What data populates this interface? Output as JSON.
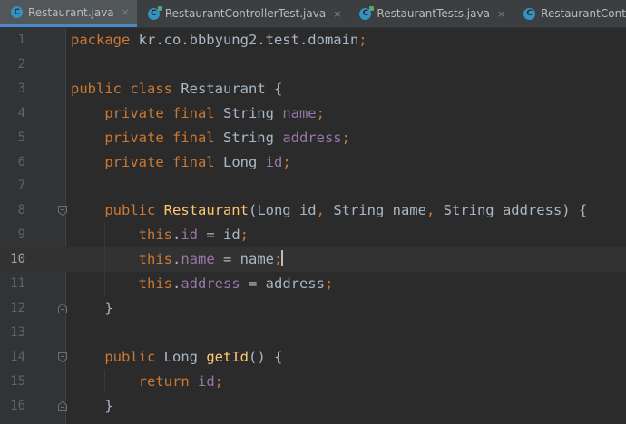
{
  "tabs": [
    {
      "label": "Restaurant.java",
      "icon": "class-icon",
      "active": true,
      "closable": true
    },
    {
      "label": "RestaurantControllerTest.java",
      "icon": "test-class-icon",
      "active": false,
      "closable": true
    },
    {
      "label": "RestaurantTests.java",
      "icon": "test-class-icon",
      "active": false,
      "closable": true
    },
    {
      "label": "RestaurantController.java",
      "icon": "class-icon",
      "active": false,
      "closable": false
    }
  ],
  "tab_close_glyph": "×",
  "tab_icon_letter": "C",
  "editor": {
    "current_line": 10,
    "line_numbers": [
      "1",
      "2",
      "3",
      "4",
      "5",
      "6",
      "7",
      "8",
      "9",
      "10",
      "11",
      "12",
      "13",
      "14",
      "15",
      "16"
    ],
    "lines": [
      [
        {
          "t": "package kr.co.bbbyung2.test.domain",
          "c": "kw-pkg"
        },
        {
          "t": ";",
          "c": "kw"
        }
      ],
      [],
      [
        {
          "t": "public class ",
          "c": "kw"
        },
        {
          "t": "Restaurant {",
          "c": ""
        }
      ],
      [
        {
          "t": "    private final ",
          "c": "kw"
        },
        {
          "t": "String ",
          "c": ""
        },
        {
          "t": "name",
          "c": "fld"
        },
        {
          "t": ";",
          "c": "kw"
        }
      ],
      [
        {
          "t": "    private final ",
          "c": "kw"
        },
        {
          "t": "String ",
          "c": ""
        },
        {
          "t": "address",
          "c": "fld"
        },
        {
          "t": ";",
          "c": "kw"
        }
      ],
      [
        {
          "t": "    private final ",
          "c": "kw"
        },
        {
          "t": "Long ",
          "c": ""
        },
        {
          "t": "id",
          "c": "fld"
        },
        {
          "t": ";",
          "c": "kw"
        }
      ],
      [],
      [
        {
          "t": "    public ",
          "c": "kw"
        },
        {
          "t": "Restaurant",
          "c": "fn"
        },
        {
          "t": "(Long id",
          "c": ""
        },
        {
          "t": ", ",
          "c": "kw"
        },
        {
          "t": "String name",
          "c": ""
        },
        {
          "t": ", ",
          "c": "kw"
        },
        {
          "t": "String address) {",
          "c": ""
        }
      ],
      [
        {
          "t": "        this",
          "c": "kw"
        },
        {
          "t": ".",
          "c": ""
        },
        {
          "t": "id",
          "c": "fld"
        },
        {
          "t": " = id",
          "c": ""
        },
        {
          "t": ";",
          "c": "kw"
        }
      ],
      [
        {
          "t": "        this",
          "c": "kw"
        },
        {
          "t": ".",
          "c": ""
        },
        {
          "t": "name",
          "c": "fld"
        },
        {
          "t": " = name",
          "c": ""
        },
        {
          "t": ";",
          "c": "kw"
        },
        {
          "t": "",
          "c": "caret"
        }
      ],
      [
        {
          "t": "        this",
          "c": "kw"
        },
        {
          "t": ".",
          "c": ""
        },
        {
          "t": "address",
          "c": "fld"
        },
        {
          "t": " = address",
          "c": ""
        },
        {
          "t": ";",
          "c": "kw"
        }
      ],
      [
        {
          "t": "    }",
          "c": ""
        }
      ],
      [],
      [
        {
          "t": "    public ",
          "c": "kw"
        },
        {
          "t": "Long ",
          "c": ""
        },
        {
          "t": "getId",
          "c": "fn"
        },
        {
          "t": "() {",
          "c": ""
        }
      ],
      [
        {
          "t": "        return ",
          "c": "kw"
        },
        {
          "t": "id",
          "c": "fld"
        },
        {
          "t": ";",
          "c": "kw"
        }
      ],
      [
        {
          "t": "    }",
          "c": ""
        }
      ]
    ],
    "fold_markers": [
      8,
      12,
      14,
      16
    ]
  },
  "colors": {
    "background": "#2b2b2b",
    "gutter": "#313335",
    "keyword": "#cc7832",
    "field": "#9876aa",
    "method": "#ffc66d",
    "text": "#a9b7c6",
    "line_number": "#606366",
    "active_tab_underline": "#4a88c7"
  }
}
